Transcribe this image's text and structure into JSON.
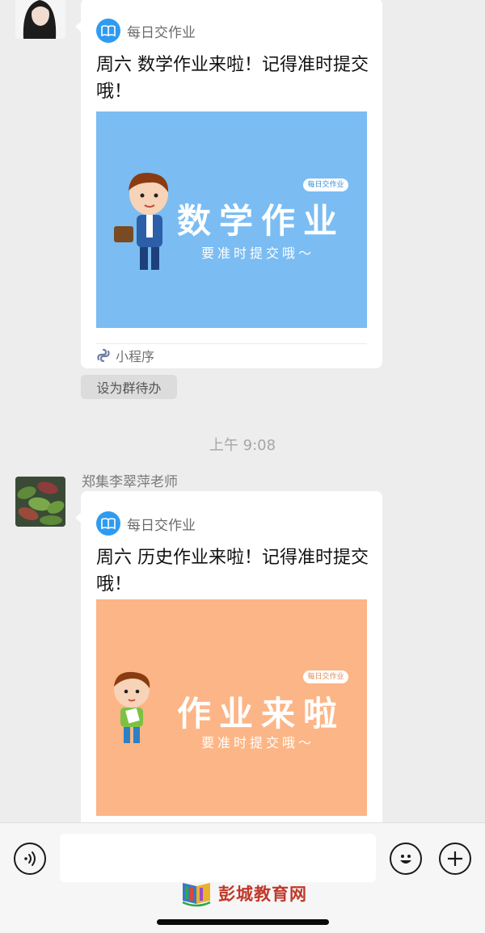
{
  "messages": [
    {
      "card": {
        "app_name": "每日交作业",
        "title": "周六 数学作业来啦！记得准时提交哦！",
        "thumbnail": {
          "badge": "每日交作业",
          "headline": "数学作业",
          "subline": "要准时提交哦～",
          "color": "#7bbcf2"
        },
        "footer_label": "小程序"
      },
      "action_label": "设为群待办"
    },
    {
      "sender": "郑集李翠萍老师",
      "card": {
        "app_name": "每日交作业",
        "title": "周六 历史作业来啦！记得准时提交哦！",
        "thumbnail": {
          "badge": "每日交作业",
          "headline": "作业来啦",
          "subline": "要准时提交哦～",
          "color": "#fcb586"
        }
      }
    }
  ],
  "time_separator": "上午 9:08",
  "input_bar": {
    "voice_icon": "voice-icon",
    "emoji_icon": "emoji-icon",
    "plus_icon": "plus-icon",
    "input_value": ""
  },
  "watermark": {
    "text": "彭城教育网"
  }
}
